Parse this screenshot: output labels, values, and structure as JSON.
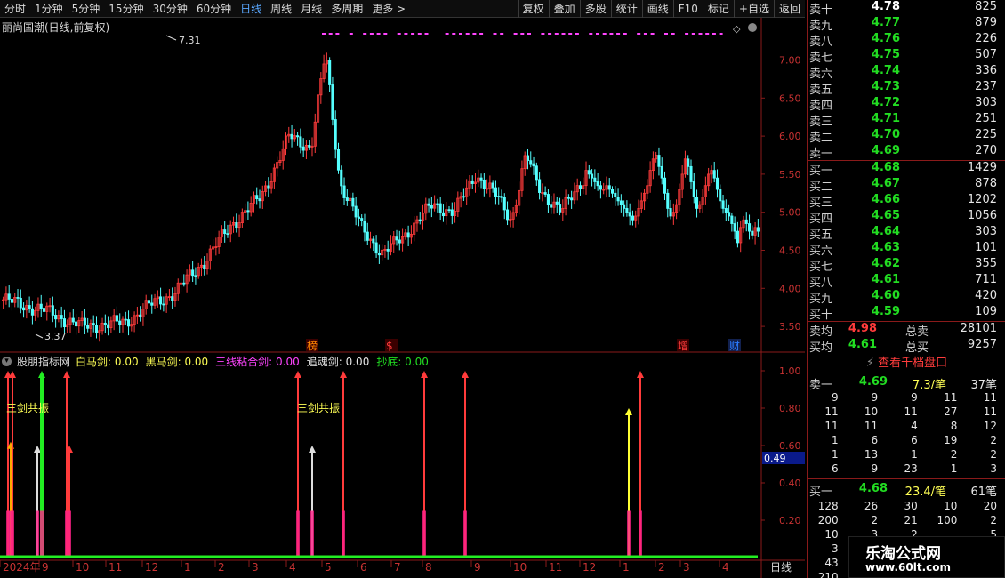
{
  "toolbar": {
    "periods": [
      "分时",
      "1分钟",
      "5分钟",
      "15分钟",
      "30分钟",
      "60分钟",
      "日线",
      "周线",
      "月线",
      "多周期",
      "更多 >"
    ],
    "active_period": "日线",
    "tools": [
      "复权",
      "叠加",
      "多股",
      "统计",
      "画线",
      "F10",
      "标记",
      "+自选",
      "返回"
    ]
  },
  "main_chart": {
    "title": "丽尚国潮(日线,前复权)",
    "high_label": "7.31",
    "low_label": "3.37",
    "y_ticks": [
      "7.00",
      "6.50",
      "6.00",
      "5.50",
      "5.00",
      "4.50",
      "4.00",
      "3.50"
    ],
    "event_markers": [
      "榜",
      "$",
      "增",
      "财"
    ]
  },
  "indicator": {
    "name": "股朋指标网",
    "items": [
      {
        "label": "白马剑:",
        "value": "0.00",
        "color": "#ffff55"
      },
      {
        "label": "黑马剑:",
        "value": "0.00",
        "color": "#ffff55"
      },
      {
        "label": "三线粘合剑:",
        "value": "0.00",
        "color": "#ff44ff"
      },
      {
        "label": "追魂剑:",
        "value": "0.00",
        "color": "#e6e6e6"
      },
      {
        "label": "抄底:",
        "value": "0.00",
        "color": "#22dd22"
      }
    ],
    "annotation": "三剑共振",
    "y_ticks": [
      "1.00",
      "0.80",
      "0.60",
      "0.40",
      "0.20"
    ],
    "current_value": "0.49"
  },
  "x_axis": {
    "labels": [
      "2024年",
      "9",
      "10",
      "11",
      "12",
      "1",
      "2",
      "3",
      "4",
      "5",
      "6",
      "7",
      "8",
      "9",
      "10",
      "11",
      "12",
      "1",
      "2",
      "3",
      "4"
    ],
    "period": "日线"
  },
  "orderbook": {
    "asks": [
      {
        "label": "卖十",
        "price": "4.78",
        "vol": "825"
      },
      {
        "label": "卖九",
        "price": "4.77",
        "vol": "879"
      },
      {
        "label": "卖八",
        "price": "4.76",
        "vol": "226"
      },
      {
        "label": "卖七",
        "price": "4.75",
        "vol": "507"
      },
      {
        "label": "卖六",
        "price": "4.74",
        "vol": "336"
      },
      {
        "label": "卖五",
        "price": "4.73",
        "vol": "237"
      },
      {
        "label": "卖四",
        "price": "4.72",
        "vol": "303"
      },
      {
        "label": "卖三",
        "price": "4.71",
        "vol": "251"
      },
      {
        "label": "卖二",
        "price": "4.70",
        "vol": "225"
      },
      {
        "label": "卖一",
        "price": "4.69",
        "vol": "270"
      }
    ],
    "bids": [
      {
        "label": "买一",
        "price": "4.68",
        "vol": "1429"
      },
      {
        "label": "买二",
        "price": "4.67",
        "vol": "878"
      },
      {
        "label": "买三",
        "price": "4.66",
        "vol": "1202"
      },
      {
        "label": "买四",
        "price": "4.65",
        "vol": "1056"
      },
      {
        "label": "买五",
        "price": "4.64",
        "vol": "303"
      },
      {
        "label": "买六",
        "price": "4.63",
        "vol": "101"
      },
      {
        "label": "买七",
        "price": "4.62",
        "vol": "355"
      },
      {
        "label": "买八",
        "price": "4.61",
        "vol": "711"
      },
      {
        "label": "买九",
        "price": "4.60",
        "vol": "420"
      },
      {
        "label": "买十",
        "price": "4.59",
        "vol": "109"
      }
    ],
    "ask_avg": {
      "label": "卖均",
      "price": "4.98",
      "total_label": "总卖",
      "total": "28101"
    },
    "bid_avg": {
      "label": "买均",
      "price": "4.61",
      "total_label": "总买",
      "total": "9257"
    },
    "thousand_button": "查看千档盘口",
    "sell1_summary": {
      "label": "卖一",
      "price": "4.69",
      "avg": "7.3/笔",
      "count": "37笔"
    },
    "sell1_ticks": [
      [
        "9",
        "9",
        "9",
        "11",
        "11"
      ],
      [
        "11",
        "10",
        "11",
        "27",
        "11"
      ],
      [
        "11",
        "11",
        "4",
        "8",
        "12"
      ],
      [
        "1",
        "6",
        "6",
        "19",
        "2"
      ],
      [
        "1",
        "13",
        "1",
        "2",
        "2"
      ],
      [
        "6",
        "9",
        "23",
        "1",
        "3"
      ]
    ],
    "buy1_summary": {
      "label": "买一",
      "price": "4.68",
      "avg": "23.4/笔",
      "count": "61笔"
    },
    "buy1_ticks": [
      [
        "128",
        "26",
        "30",
        "10",
        "20"
      ],
      [
        "200",
        "2",
        "21",
        "100",
        "2"
      ],
      [
        "10",
        "3",
        "2",
        "",
        "5"
      ],
      [
        "3",
        "",
        "",
        "",
        ""
      ],
      [
        "43",
        "",
        "",
        "",
        ""
      ],
      [
        "210",
        "",
        "",
        "",
        ""
      ]
    ]
  },
  "watermark": {
    "name": "乐淘公式网",
    "url": "www.60lt.com"
  },
  "colors": {
    "up": "#ff3b3b",
    "down": "#54ffff",
    "flat": "#e6e6e6",
    "avg_sell": "#ff3b3b"
  }
}
